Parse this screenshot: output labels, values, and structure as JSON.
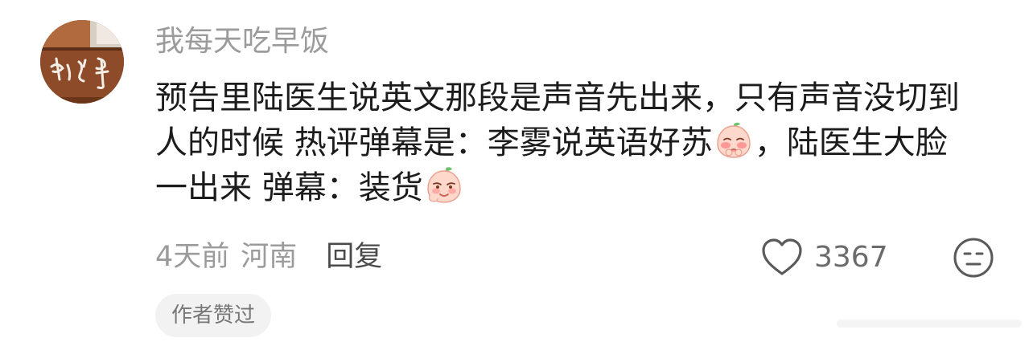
{
  "comment": {
    "username": "我每天吃早饭",
    "content_lines": [
      "预告里陆医生说英文那段是声音先出来，只有声音没切到",
      "人的时候 热评弹幕是：李雾说英语好苏",
      "，陆医生大脸",
      "一出来 弹幕：装货"
    ],
    "emoji_1": "blush-emoji-icon",
    "emoji_2": "smirk-emoji-icon",
    "time": "4天前",
    "region": "河南",
    "reply_label": "回复",
    "like_count": "3367",
    "author_badge": "作者赞过"
  },
  "colors": {
    "username": "#9b9b9b",
    "content": "#1c1c1c",
    "meta": "#9b9b9b",
    "reply": "#4a4a4a",
    "badge_bg": "#f2f2f2",
    "icon_stroke": "#5a5a5a"
  }
}
